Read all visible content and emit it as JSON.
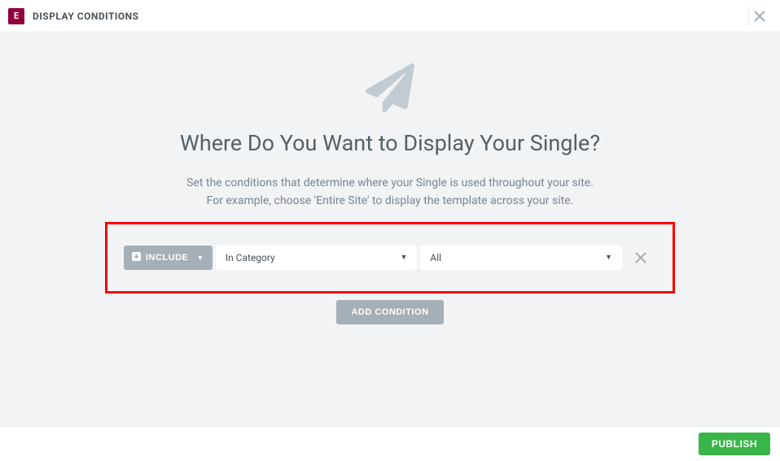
{
  "header": {
    "title": "DISPLAY CONDITIONS"
  },
  "main": {
    "heading": "Where Do You Want to Display Your Single?",
    "desc_line1": "Set the conditions that determine where your Single is used throughout your site.",
    "desc_line2": "For example, choose 'Entire Site' to display the template across your site."
  },
  "condition": {
    "include_label": "INCLUDE",
    "category_select": "In Category",
    "value_select": "All"
  },
  "buttons": {
    "add_condition": "ADD CONDITION",
    "publish": "PUBLISH"
  }
}
